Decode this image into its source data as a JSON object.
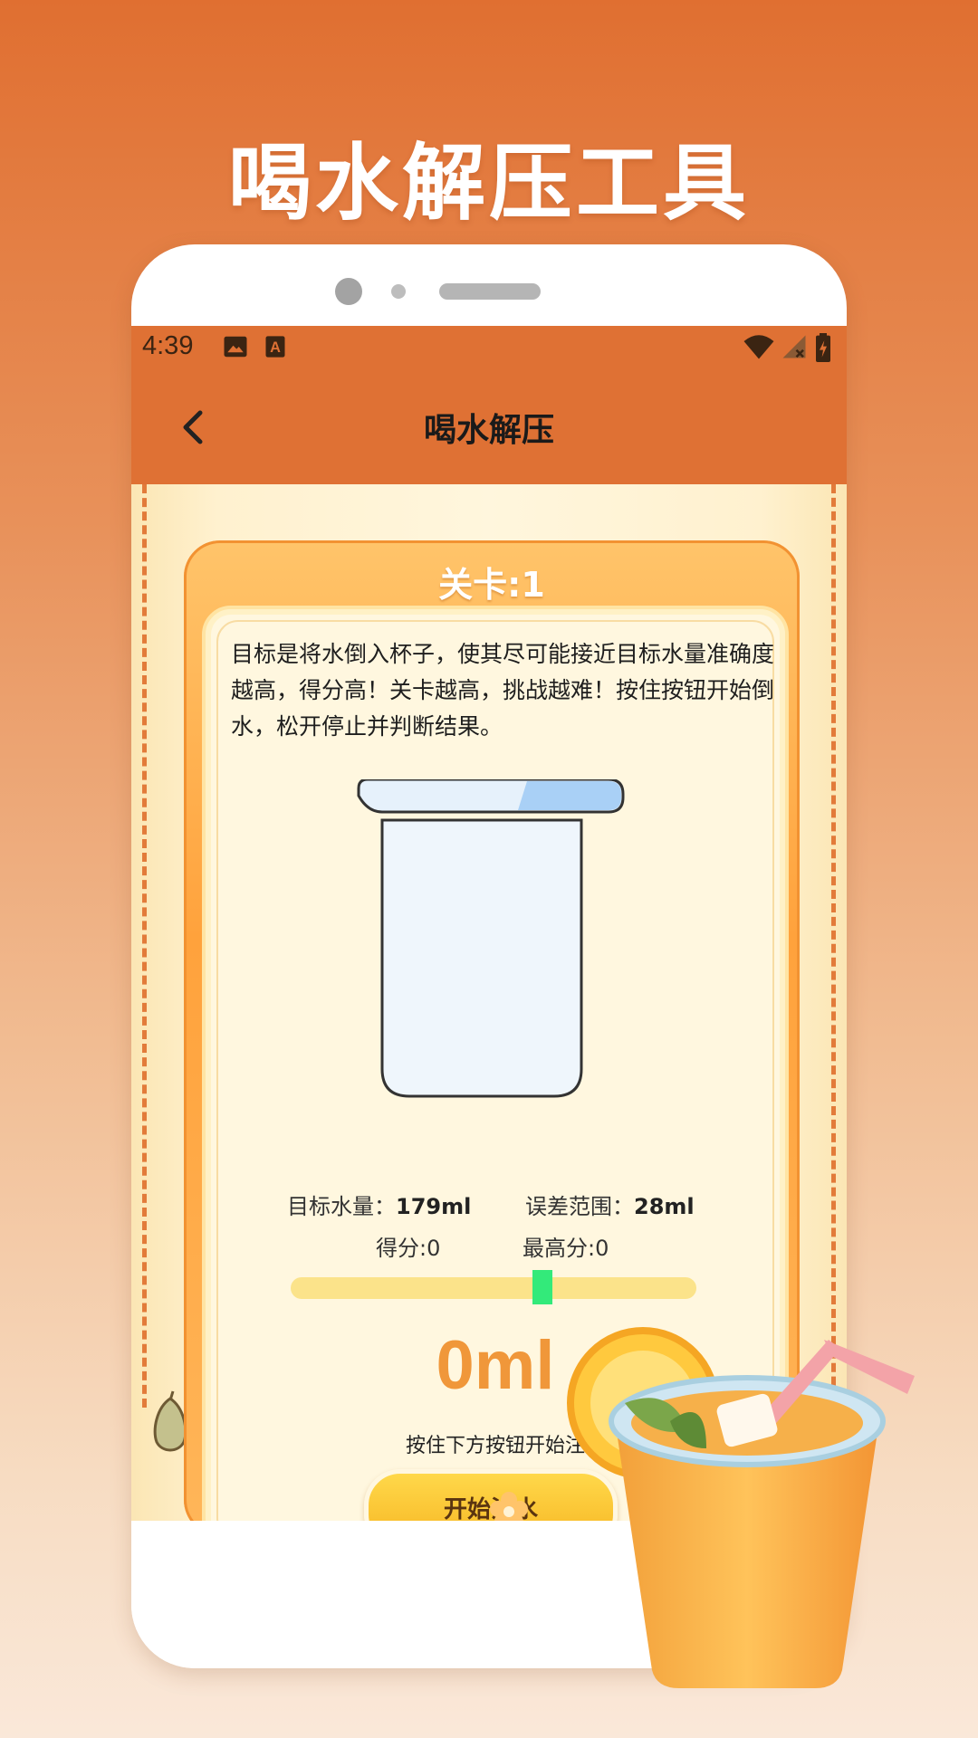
{
  "headline": "喝水解压工具",
  "status_bar": {
    "time": "4:39",
    "icons": [
      "image-icon",
      "a-badge-icon",
      "wifi-icon",
      "signal-icon",
      "battery-icon"
    ]
  },
  "app_bar": {
    "title": "喝水解压",
    "back_icon": "chevron-left-icon"
  },
  "game": {
    "level_label": "关卡:1",
    "description": "目标是将水倒入杯子，使其尽可能接近目标水量准确度越高，得分高！关卡越高，挑战越难！按住按钮开始倒水，松开停止并判断结果。",
    "target_label": "目标水量：",
    "target_value": "179ml",
    "tolerance_label": "误差范围：",
    "tolerance_value": "28ml",
    "score": "得分:0",
    "best_score": "最高分:0",
    "slider_position": 0.62,
    "current_amount": "0ml",
    "hint": "按住下方按钮开始注",
    "start_button": "开始注水"
  },
  "colors": {
    "bar": "#df7134",
    "card_orange": "#ffa23c",
    "amount_text": "#f0973a",
    "slider_track": "#fbe38a",
    "slider_handle": "#33ea7a",
    "button": "#ffd84a"
  }
}
